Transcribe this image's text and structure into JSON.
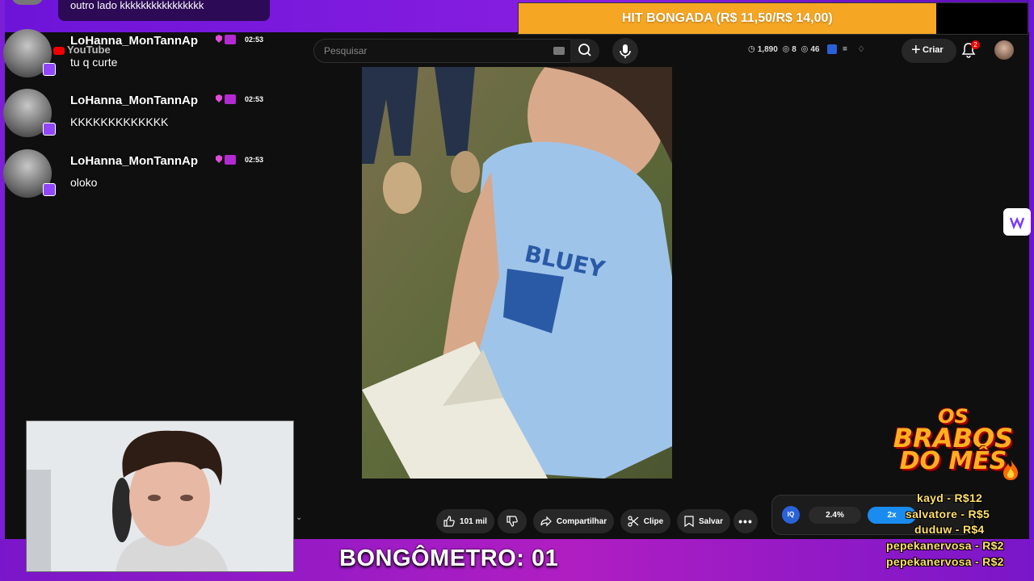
{
  "youtube": {
    "logo_text": "YouTube",
    "search_placeholder": "Pesquisar",
    "stats": {
      "watch": "1,890",
      "views": "8",
      "eyes": "46"
    },
    "create_label": "Criar",
    "notifications_count": "2"
  },
  "video_actions": {
    "likes": "101 mil",
    "share": "Compartilhar",
    "clip": "Clipe",
    "save": "Salvar"
  },
  "chat": {
    "previous_message": "outro lado kkkkkkkkkkkkkkkk",
    "messages": [
      {
        "user": "LoHanna_MonTannAp",
        "time": "02:53",
        "text": "tu q curte"
      },
      {
        "user": "LoHanna_MonTannAp",
        "time": "02:53",
        "text": "KKKKKKKKKKKKK"
      },
      {
        "user": "LoHanna_MonTannAp",
        "time": "02:53",
        "text": "oloko"
      }
    ]
  },
  "alert": {
    "text": "HIT BONGADA (R$ 11,50/R$ 14,00)",
    "progress": 0.82,
    "color": "#f5a623"
  },
  "bongometro": "BONGÔMETRO: 01",
  "brabos": {
    "title_line1": "OS",
    "title_line2": "BRABOS",
    "title_line3": "DO MÊS",
    "donors": [
      "kayd - R$12",
      "salvatore - R$5",
      "duduw - R$4",
      "pepekanervosa - R$2",
      "pepekanervosa - R$2"
    ]
  },
  "iq_widget": {
    "logo": "IQ",
    "percent": "2.4%",
    "speed": "2x"
  },
  "colors": {
    "frame": "#7b1fd6",
    "accent": "#f5a623",
    "twitch": "#9146ff"
  }
}
